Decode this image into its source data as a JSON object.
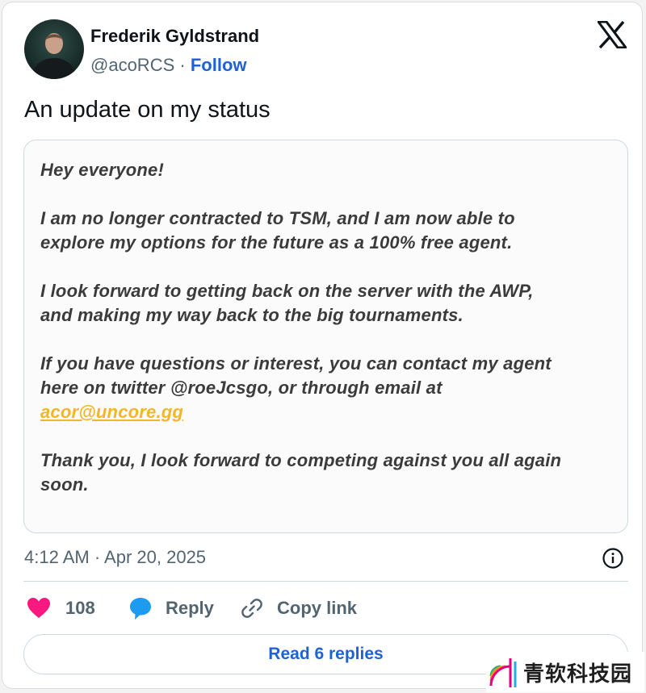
{
  "author": {
    "name": "Frederik Gyldstrand",
    "handle": "@acoRCS",
    "separator": "·",
    "follow_label": "Follow"
  },
  "tweet_text": "An update on my status",
  "embedded_note": {
    "line1": "Hey everyone!",
    "line2": "I am no longer contracted to TSM, and I am now able to",
    "line3": "explore my options for the future as a 100% free agent.",
    "line4": "I look forward to getting back on the server with the AWP,",
    "line5": "and making my way back to the big tournaments.",
    "line6": "If you have questions or interest, you can contact my agent",
    "line7": "here on twitter @roeJcsgo, or through email at",
    "email": "acor@uncore.gg",
    "line8": "Thank you, I look forward to competing against you all again",
    "line9": "soon."
  },
  "timestamp": "4:12 AM · Apr 20, 2025",
  "actions": {
    "like_count": "108",
    "reply_label": "Reply",
    "copy_link_label": "Copy link"
  },
  "read_replies_label": "Read 6 replies",
  "watermark_text": "青软科技园",
  "colors": {
    "accent": "#1d63d3",
    "like": "#f91880",
    "reply_icon": "#1d9bf0",
    "email_link": "#f3b52a"
  },
  "icons": {
    "logo": "x-logo-icon",
    "info": "info-icon",
    "like": "heart-icon",
    "reply": "speech-bubble-icon",
    "copy": "link-icon"
  }
}
